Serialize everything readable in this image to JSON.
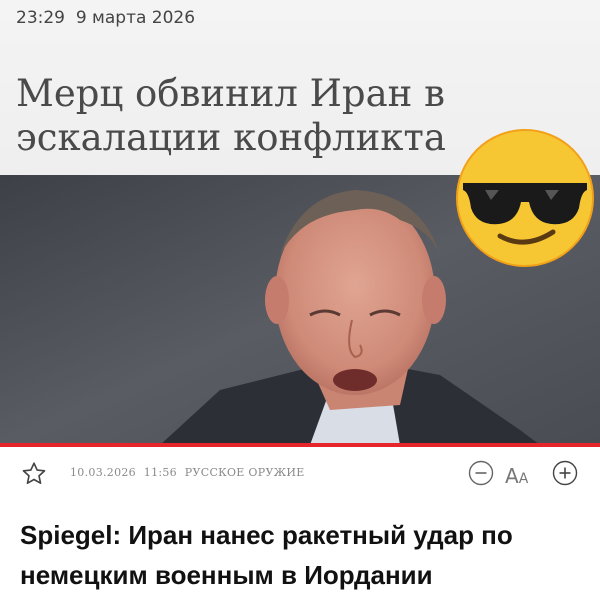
{
  "screenshot_header": {
    "time": "23:29",
    "date": "9 марта 2026",
    "headline": "Мерц обвинил Иран в эскалации конфликта"
  },
  "photo": {
    "description_icon": "portrait-photo",
    "background_color": "#55575f"
  },
  "overlay": {
    "icon": "sunglasses-emoji"
  },
  "meta": {
    "date": "10.03.2026",
    "time": "11:56",
    "category": "РУССКОЕ ОРУЖИЕ"
  },
  "controls": {
    "bookmark_icon": "star-icon",
    "decrease_icon": "minus-circle-icon",
    "font_label_big": "А",
    "font_label_small": "А",
    "increase_icon": "plus-circle-icon"
  },
  "article": {
    "title": "Spiegel: Иран нанес ракетный удар по немецким военным в Иордании"
  },
  "colors": {
    "accent": "#e6252b",
    "text": "#111111",
    "meta": "#8a8a8a"
  }
}
